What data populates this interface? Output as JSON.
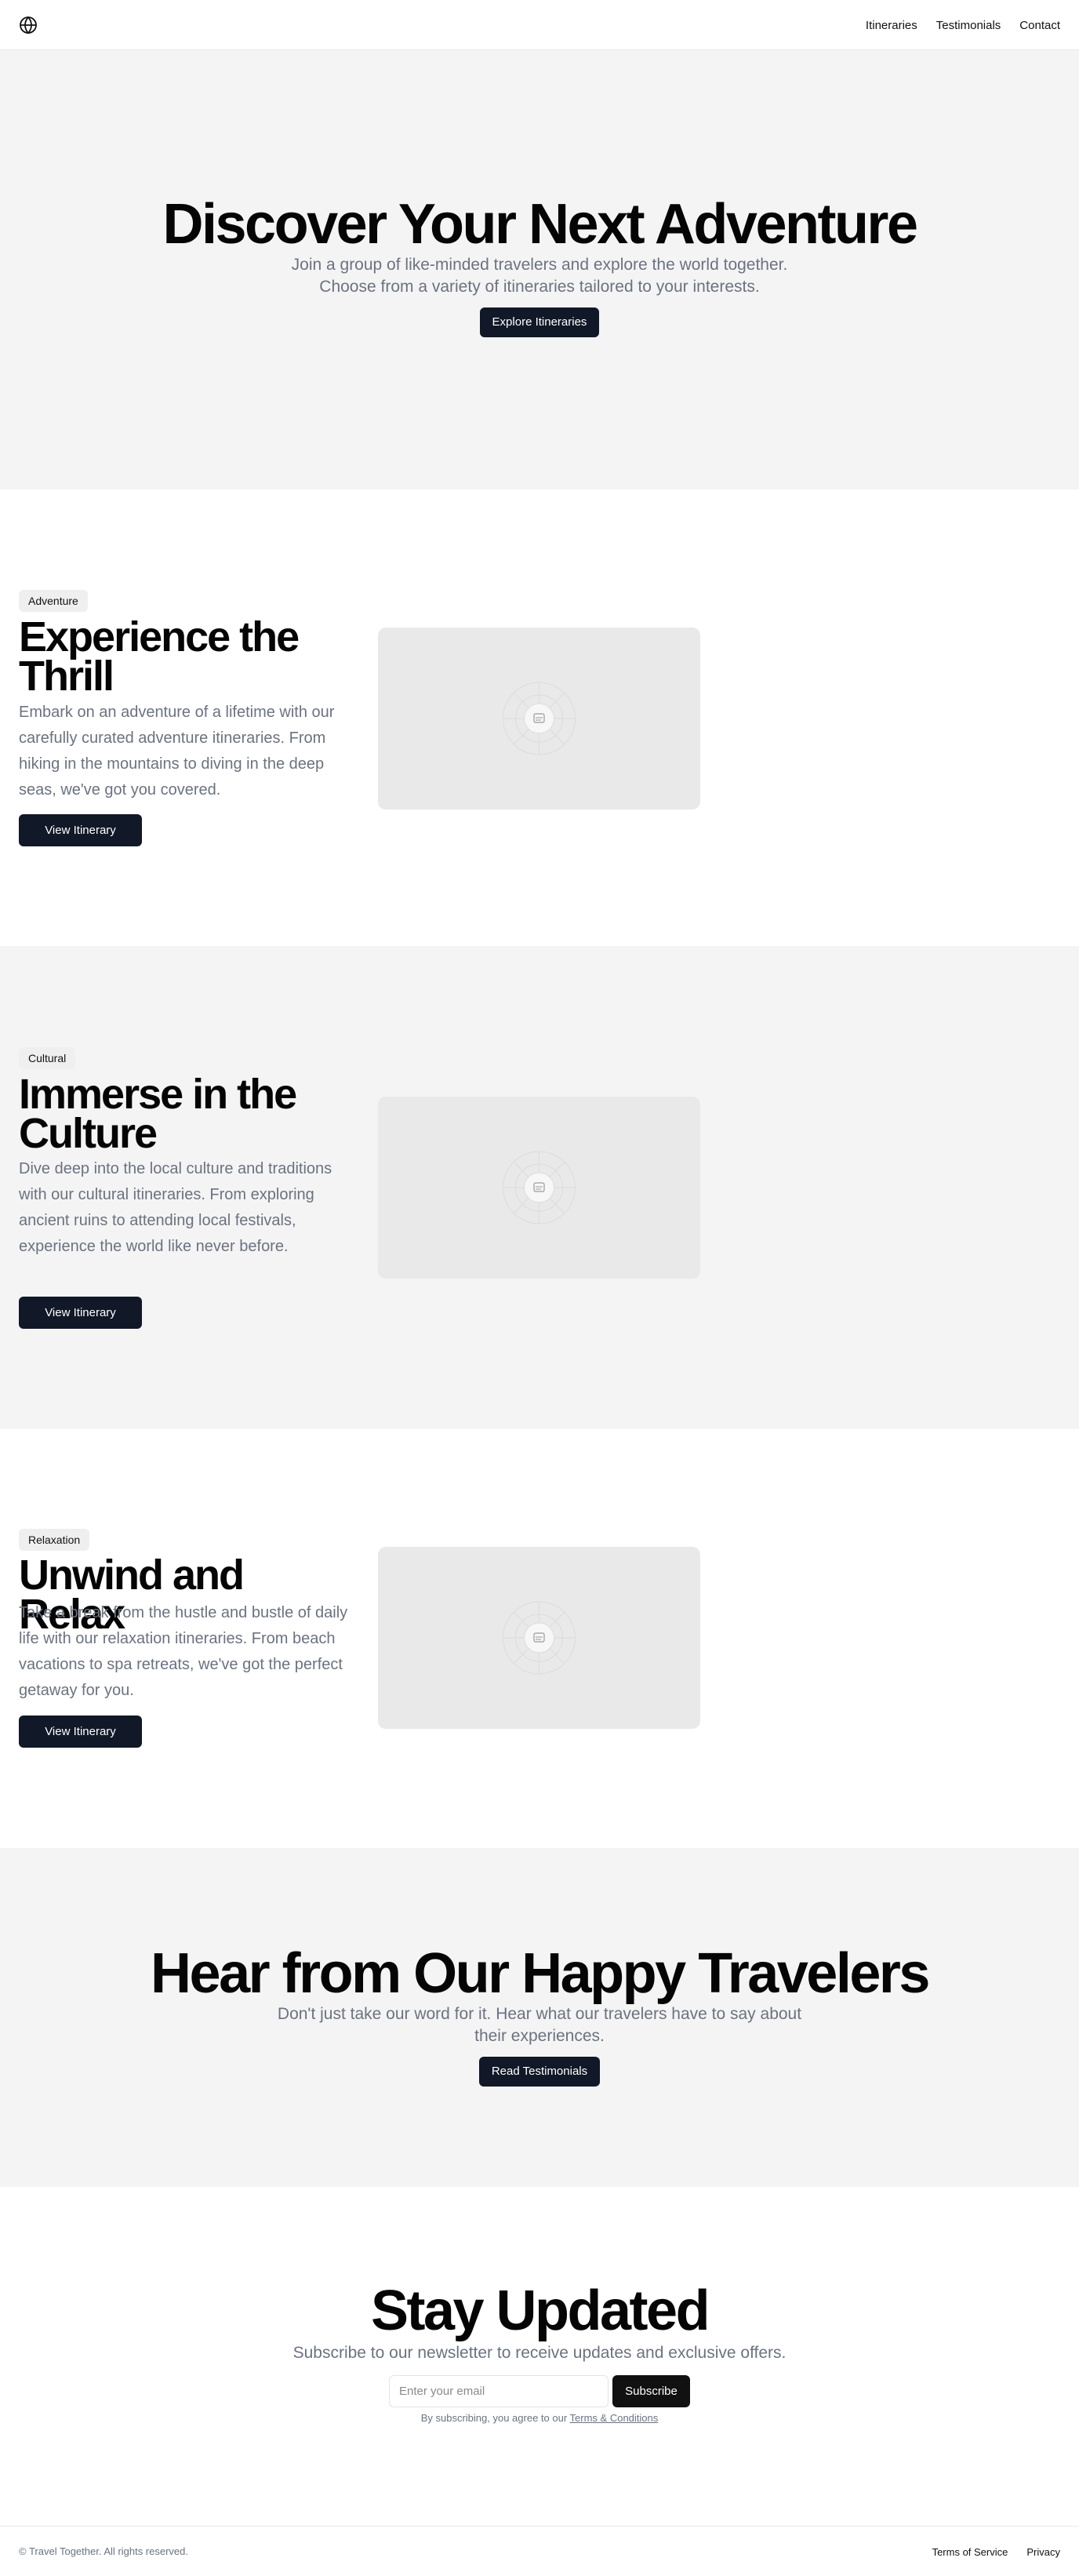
{
  "header": {
    "logo_icon": "globe-icon",
    "nav": [
      "Itineraries",
      "Testimonials",
      "Contact"
    ]
  },
  "hero": {
    "title": "Discover Your Next Adventure",
    "subtitle_line1": "Join a group of like-minded travelers and explore the world together.",
    "subtitle_line2": "Choose from a variety of itineraries tailored to your interests.",
    "button": "Explore Itineraries"
  },
  "features": [
    {
      "badge": "Adventure",
      "title": "Experience the Thrill",
      "description": "Embark on an adventure of a lifetime with our carefully curated adventure itineraries. From hiking in the mountains to diving in the deep seas, we've got you covered.",
      "button": "View Itinerary",
      "image_icon": "image-placeholder-icon"
    },
    {
      "badge": "Cultural",
      "title": "Immerse in the Culture",
      "description": "Dive deep into the local culture and traditions with our cultural itineraries. From exploring ancient ruins to attending local festivals, experience the world like never before.",
      "button": "View Itinerary",
      "image_icon": "image-placeholder-icon"
    },
    {
      "badge": "Relaxation",
      "title": "Unwind and Relax",
      "description": "Take a break from the hustle and bustle of daily life with our relaxation itineraries. From beach vacations to spa retreats, we've got the perfect getaway for you.",
      "button": "View Itinerary",
      "image_icon": "image-placeholder-icon"
    }
  ],
  "testimonials": {
    "title": "Hear from Our Happy Travelers",
    "subtitle_line1": "Don't just take our word for it. Hear what our travelers have to say about",
    "subtitle_line2": "their experiences.",
    "button": "Read Testimonials"
  },
  "newsletter": {
    "title": "Stay Updated",
    "subtitle": "Subscribe to our newsletter to receive updates and exclusive offers.",
    "email_placeholder": "Enter your email",
    "email_value": "",
    "button": "Subscribe",
    "terms_prefix": "By subscribing, you agree to our ",
    "terms_link": "Terms & Conditions"
  },
  "footer": {
    "copyright": "© Travel Together. All rights reserved.",
    "links": [
      "Terms of Service",
      "Privacy"
    ]
  },
  "colors": {
    "primary_button": "#111827",
    "muted_text": "#6b7280",
    "gray_band": "#f4f4f4",
    "placeholder": "#e9e9e9"
  }
}
